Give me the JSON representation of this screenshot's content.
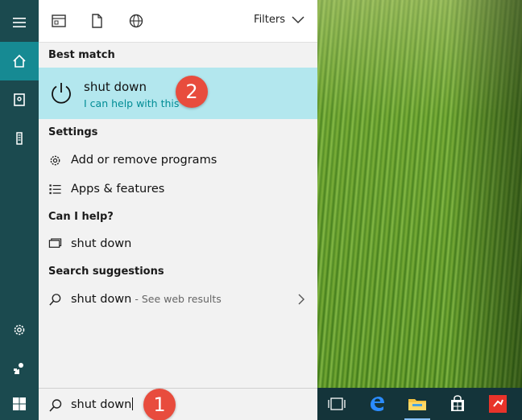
{
  "topbar": {
    "filters_label": "Filters"
  },
  "best_match": {
    "header": "Best match",
    "title": "shut down",
    "subtitle": "I can help with this"
  },
  "settings": {
    "header": "Settings",
    "items": [
      {
        "label": "Add or remove programs",
        "icon": "gear-icon"
      },
      {
        "label": "Apps & features",
        "icon": "list-icon"
      }
    ]
  },
  "can_i_help": {
    "header": "Can I help?",
    "items": [
      {
        "label": "shut down",
        "icon": "chat-icon"
      }
    ]
  },
  "suggestions": {
    "header": "Search suggestions",
    "items": [
      {
        "label": "shut down",
        "hint": " - See web results",
        "icon": "search-icon"
      }
    ]
  },
  "search": {
    "value": "shut down"
  },
  "annotations": {
    "badge1": "1",
    "badge2": "2"
  },
  "colors": {
    "accent": "#168a93",
    "highlight": "#b3e7ee",
    "badge": "#e84c3d",
    "rail": "#1b4a4f"
  }
}
